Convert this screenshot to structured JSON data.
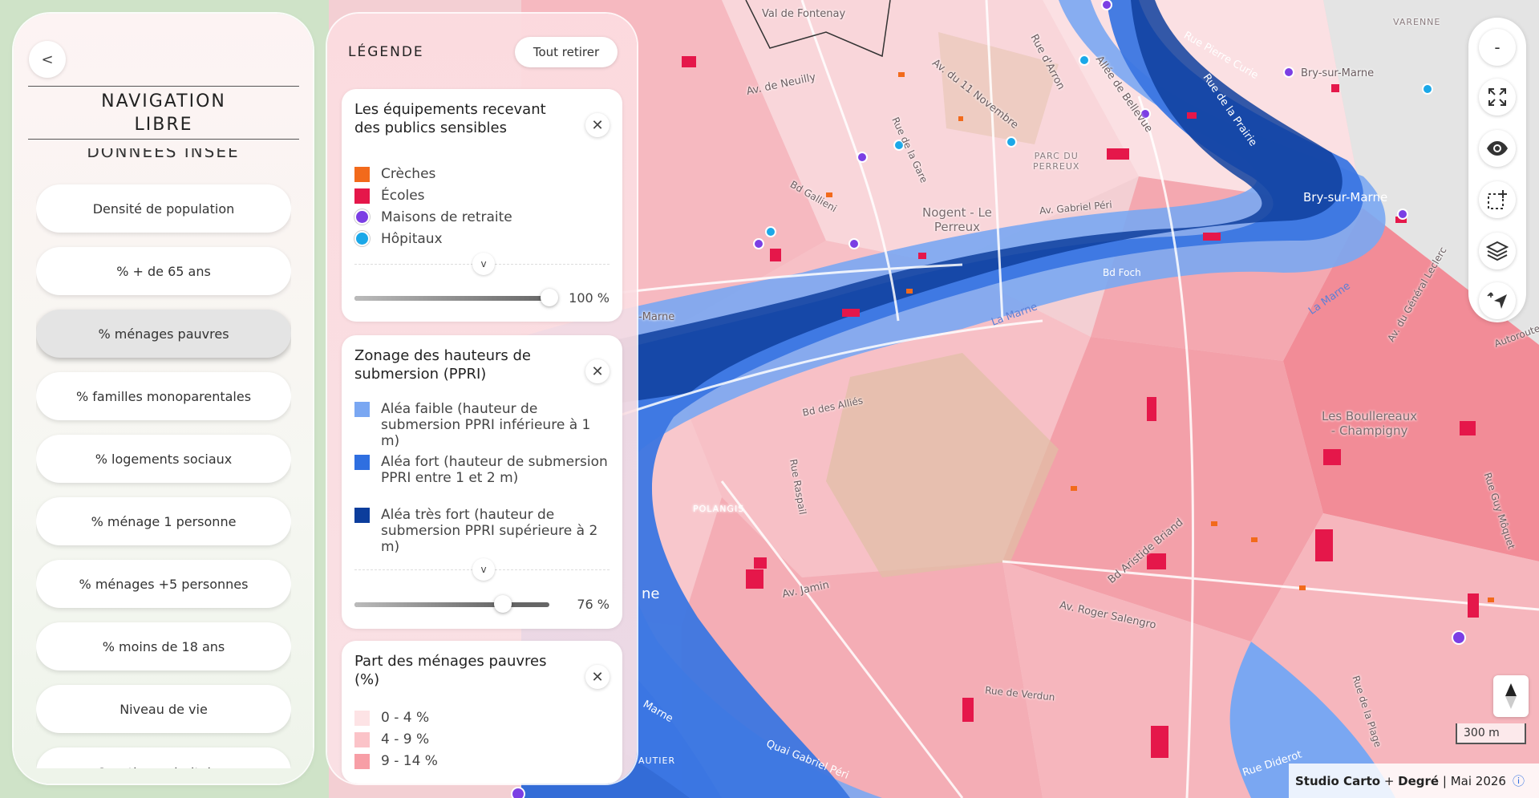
{
  "nav": {
    "back_label": "<",
    "title": "NAVIGATION\nLIBRE",
    "section_title": "DONNÉES INSEE",
    "items": [
      {
        "label": "Densité de population"
      },
      {
        "label": "% + de 65 ans"
      },
      {
        "label": "% ménages pauvres"
      },
      {
        "label": "% familles monoparentales"
      },
      {
        "label": "% logements sociaux"
      },
      {
        "label": "% ménage 1 personne"
      },
      {
        "label": "% ménages +5 personnes"
      },
      {
        "label": "% moins de 18 ans"
      },
      {
        "label": "Niveau de vie"
      },
      {
        "label": "Quartiers prioritaires"
      }
    ],
    "active_item": "% ménages pauvres"
  },
  "legend": {
    "title": "LÉGENDE",
    "remove_all_label": "Tout retirer",
    "expand_label": "v",
    "close_label": "✕",
    "cards": [
      {
        "title": "Les équipements recevant des publics sensibles",
        "entries": [
          {
            "label": "Crèches",
            "color": "#f26a1b",
            "shape": "square"
          },
          {
            "label": "Écoles",
            "color": "#e5174a",
            "shape": "square"
          },
          {
            "label": "Maisons de retraite",
            "color": "#7b3fe4",
            "shape": "circle"
          },
          {
            "label": "Hôpitaux",
            "color": "#1ba8e8",
            "shape": "circle"
          }
        ],
        "opacity_value": "100 %",
        "opacity": 1.0
      },
      {
        "title": "Zonage des hauteurs de submersion (PPRI)",
        "entries": [
          {
            "label": "Aléa faible (hauteur de submersion PPRI inférieure à 1 m)",
            "color": "#7aa7f2",
            "shape": "square"
          },
          {
            "label": "Aléa fort (hauteur de submersion PPRI entre 1 et 2 m)",
            "color": "#2f6fe0",
            "shape": "square"
          },
          {
            "label": "Aléa très fort (hauteur de submersion PPRI supérieure à 2 m)",
            "color": "#0c3d9c",
            "shape": "square"
          }
        ],
        "opacity_value": "76 %",
        "opacity": 0.76
      },
      {
        "title": "Part des ménages pauvres (%)",
        "entries": [
          {
            "label": "0 - 4 %",
            "color": "#fde3e5",
            "shape": "square"
          },
          {
            "label": "4 - 9 %",
            "color": "#fbc3c8",
            "shape": "square"
          },
          {
            "label": "9 - 14 %",
            "color": "#f79ea6",
            "shape": "square"
          }
        ]
      }
    ]
  },
  "toolbar": {
    "zoom_out_label": "-",
    "buttons": [
      "minus-icon",
      "fullscreen-icon",
      "eye-icon",
      "select-area-icon",
      "layers-icon",
      "locate-icon"
    ]
  },
  "map": {
    "labels": {
      "val_de_fontenay": "Val de Fontenay",
      "varenne": "VARENNE",
      "bry": "Bry-sur-Marne",
      "bry_big": "Bry-sur-Marne",
      "nogent": "Nogent - Le\nPerreux",
      "parc": "PARC DU\nPERREUX",
      "av_neuilly": "Av. de Neuilly",
      "av_11nov": "Av. du 11 Novembre",
      "rue_arron": "Rue d'Arron",
      "allee_bellevue": "Allée de Bellevue",
      "rue_pierre_curie": "Rue Pierre Curie",
      "rue_prairie": "Rue de la Prairie",
      "av_gabriel_peri": "Av. Gabriel Péri",
      "bd_gallieni": "Bd Gallieni",
      "rue_vezelay": "Rue de la Gare",
      "bd_foch": "Bd Foch",
      "la_marne": "La Marne",
      "la_marne2": "La Marne",
      "marne_left": "-Marne",
      "bd_alsace": "Bd des Alliés",
      "rue_raspail": "Rue Raspail",
      "polangis": "POLANGIS",
      "av_jamin": "Av. Jamin",
      "bd_aristide": "Bd Aristide Briand",
      "av_roger": "Av. Roger Salengro",
      "rue_verdun": "Rue de Verdun",
      "quai_gabriel": "Quai Gabriel Péri",
      "boulereaux": "Les Boullereaux\n- Champigny",
      "rue_plage": "Rue de la Plage",
      "rue_diderot": "Rue Diderot",
      "av_general_leclerc": "Av. du Général Leclerc",
      "autier": "AUTIER",
      "rue_guy": "Rue Guy Môquet",
      "autoroute": "Autoroute",
      "marne_bottom": "Marne",
      "ne": "ne"
    }
  },
  "scale_label": "300 m",
  "credits": {
    "studio": "Studio Carto",
    "plus": " + ",
    "degre": "Degré",
    "sep": " | ",
    "date": "Mai 2026",
    "info": "ⓘ"
  }
}
